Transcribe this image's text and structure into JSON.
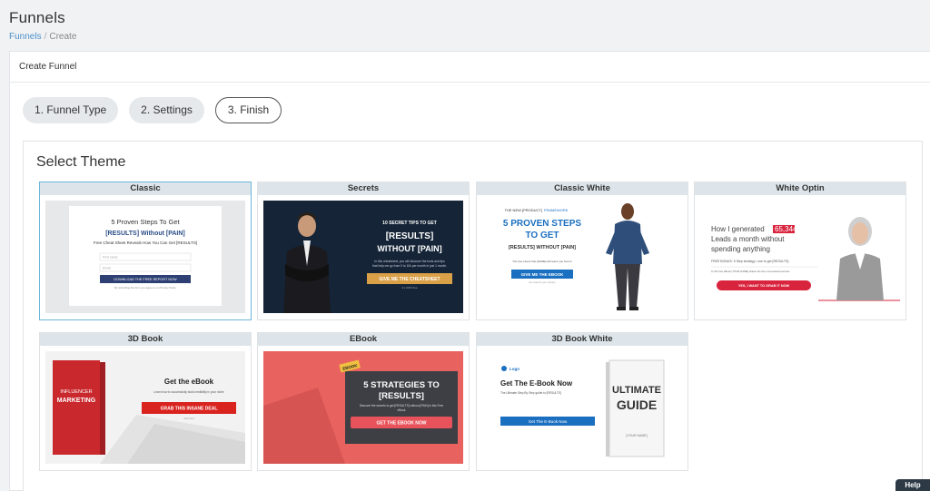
{
  "page": {
    "title": "Funnels"
  },
  "breadcrumb": {
    "root": "Funnels",
    "sep": "/",
    "current": "Create"
  },
  "panel": {
    "heading": "Create Funnel"
  },
  "steps": [
    {
      "label": "1. Funnel Type"
    },
    {
      "label": "2. Settings"
    },
    {
      "label": "3. Finish"
    }
  ],
  "themes": {
    "title": "Select Theme",
    "cards": [
      {
        "title": "Classic"
      },
      {
        "title": "Secrets"
      },
      {
        "title": "Classic White"
      },
      {
        "title": "White Optin"
      },
      {
        "title": "3D Book"
      },
      {
        "title": "EBook"
      },
      {
        "title": "3D Book White"
      }
    ]
  },
  "thumbs": {
    "classic": {
      "headline": "5 Proven Steps To Get",
      "headline2": "[RESULTS] Without [PAIN]",
      "sub": "Free Cheat Sheet Reveals How You Can Get [RESULTS]",
      "field1": "First name",
      "field2": "Email",
      "cta": "DOWNLOAD THE FREE REPORT NOW",
      "privacy": "By submitting this form you agree to our Privacy Policy"
    },
    "secrets": {
      "l1": "10 SECRET TIPS TO GET",
      "l2": "[RESULTS]",
      "l3": "WITHOUT [PAIN]",
      "body": "In this cheatsheet, you will discover the tools and tips",
      "body2": "that help me go from 0 to 10k per month in just 1 month.",
      "cta": "GIVE ME THE CHEATSHEET",
      "ctasub": "it's 100% free"
    },
    "classicwhite": {
      "pre1": "THE NEW [PRODUCT]",
      "pre2": "FRAMEWORK",
      "l1": "5 PROVEN STEPS",
      "l2": "TO GET",
      "l3": "[RESULTS] WITHOUT [PAIN]",
      "body": "The free ebook that [NAME] will teach you how to",
      "cta": "GIVE ME THE EBOOK",
      "ctasub": "we respect your privacy"
    },
    "whiteoptin": {
      "l1": "How I generated",
      "num": "65,344",
      "l2": "Leads a month without",
      "l3": "spending anything",
      "body": "FREE BONUS: 5 Step strategy I use to get [RESULTS]",
      "body2": "In this free eBook [YOUR NAME] shares his five most-wanted secrets",
      "cta": "YES, I WANT TO GRAB IT NOW"
    },
    "book3d": {
      "book1": "INFLUENCER",
      "book2": "MARKETING",
      "head": "Get the eBook",
      "body": "Learn how to successfully build credibility in your niche",
      "cta": "GRAB THIS INSANE DEAL",
      "ctasub": "click here"
    },
    "ebook": {
      "badge": "EBOOK",
      "l1": "5 STRATEGIES TO",
      "l2": "[RESULTS]",
      "body": "Discover the secrets to get [RESULTS] without [PAIN] in this Free",
      "body2": "eBook",
      "cta": "GET THE EBOOK NOW"
    },
    "book3dwhite": {
      "logo": "Logo",
      "head": "Get The E-Book Now",
      "body": "The Ultimate Step By Step guide to [RESULTS]",
      "cta": "Get The E-Book Now",
      "book1": "ULTIMATE",
      "book2": "GUIDE",
      "author": "[YOUR NAME]"
    }
  },
  "help": {
    "label": "Help"
  }
}
